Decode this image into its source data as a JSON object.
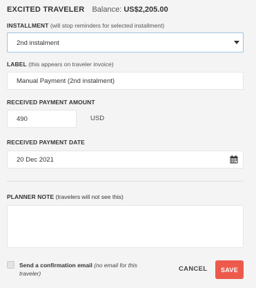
{
  "header": {
    "traveler_name": "EXCITED TRAVELER",
    "balance_label": "Balance:",
    "balance_value": "US$2,205.00"
  },
  "installment": {
    "label": "INSTALLMENT",
    "hint": "(will stop reminders for selected installment)",
    "selected": "2nd instalment",
    "icon": "chevron-down-icon"
  },
  "payment_label": {
    "label": "LABEL",
    "hint": "(this appears on traveler invoice)",
    "value": "Manual Payment (2nd instalment)"
  },
  "amount": {
    "label": "RECEIVED PAYMENT AMOUNT",
    "value": "490",
    "currency": "USD"
  },
  "date": {
    "label": "RECEIVED PAYMENT DATE",
    "value": "20 Dec 2021",
    "icon": "calendar-icon"
  },
  "note": {
    "label": "PLANNER NOTE",
    "hint": "(travelers will not see this)",
    "value": ""
  },
  "confirmation": {
    "label": "Send a confirmation email",
    "hint": "(no email for this traveler)",
    "checked": false
  },
  "actions": {
    "cancel_label": "CANCEL",
    "save_label": "SAVE"
  },
  "colors": {
    "save_button": "#ed5a4c",
    "focus_border": "#9fc3dd",
    "background": "#f4f4f4"
  }
}
